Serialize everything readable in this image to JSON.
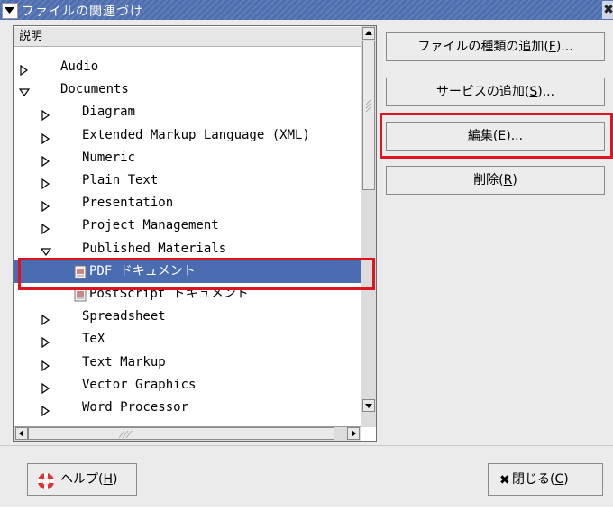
{
  "window": {
    "title": "ファイルの関連づけ"
  },
  "list": {
    "header": "説明",
    "rows": [
      {
        "label": "Audio",
        "level": 0,
        "expander": "collapsed"
      },
      {
        "label": "Documents",
        "level": 0,
        "expander": "expanded"
      },
      {
        "label": "Diagram",
        "level": 1,
        "expander": "collapsed"
      },
      {
        "label": "Extended Markup Language (XML)",
        "level": 1,
        "expander": "collapsed"
      },
      {
        "label": "Numeric",
        "level": 1,
        "expander": "collapsed"
      },
      {
        "label": "Plain Text",
        "level": 1,
        "expander": "collapsed"
      },
      {
        "label": "Presentation",
        "level": 1,
        "expander": "collapsed"
      },
      {
        "label": "Project Management",
        "level": 1,
        "expander": "collapsed"
      },
      {
        "label": "Published Materials",
        "level": 1,
        "expander": "expanded"
      },
      {
        "label": "PDF ドキュメント",
        "level": 2,
        "selected": true,
        "icon": "pdf-document-icon"
      },
      {
        "label": "PostScript ドキュメント",
        "level": 2,
        "icon": "postscript-document-icon"
      },
      {
        "label": "Spreadsheet",
        "level": 1,
        "expander": "collapsed"
      },
      {
        "label": "TeX",
        "level": 1,
        "expander": "collapsed"
      },
      {
        "label": "Text Markup",
        "level": 1,
        "expander": "collapsed"
      },
      {
        "label": "Vector Graphics",
        "level": 1,
        "expander": "collapsed"
      },
      {
        "label": "Word Processor",
        "level": 1,
        "expander": "collapsed"
      }
    ]
  },
  "buttons": {
    "add_file_type": {
      "text": "ファイルの種類の追加(",
      "key": "F",
      "suffix": ")..."
    },
    "add_service": {
      "text": "サービスの追加(",
      "key": "S",
      "suffix": ")..."
    },
    "edit": {
      "text": "編集(",
      "key": "E",
      "suffix": ")..."
    },
    "delete": {
      "text": "削除(",
      "key": "R",
      "suffix": ")"
    },
    "help": {
      "text": "ヘルプ(",
      "key": "H",
      "suffix": ")"
    },
    "close": {
      "text": "閉じる(",
      "key": "C",
      "suffix": ")"
    }
  },
  "colors": {
    "highlight": "#e0141c",
    "selection": "#4a6cb0",
    "titlebar": "#4f6eb0"
  }
}
